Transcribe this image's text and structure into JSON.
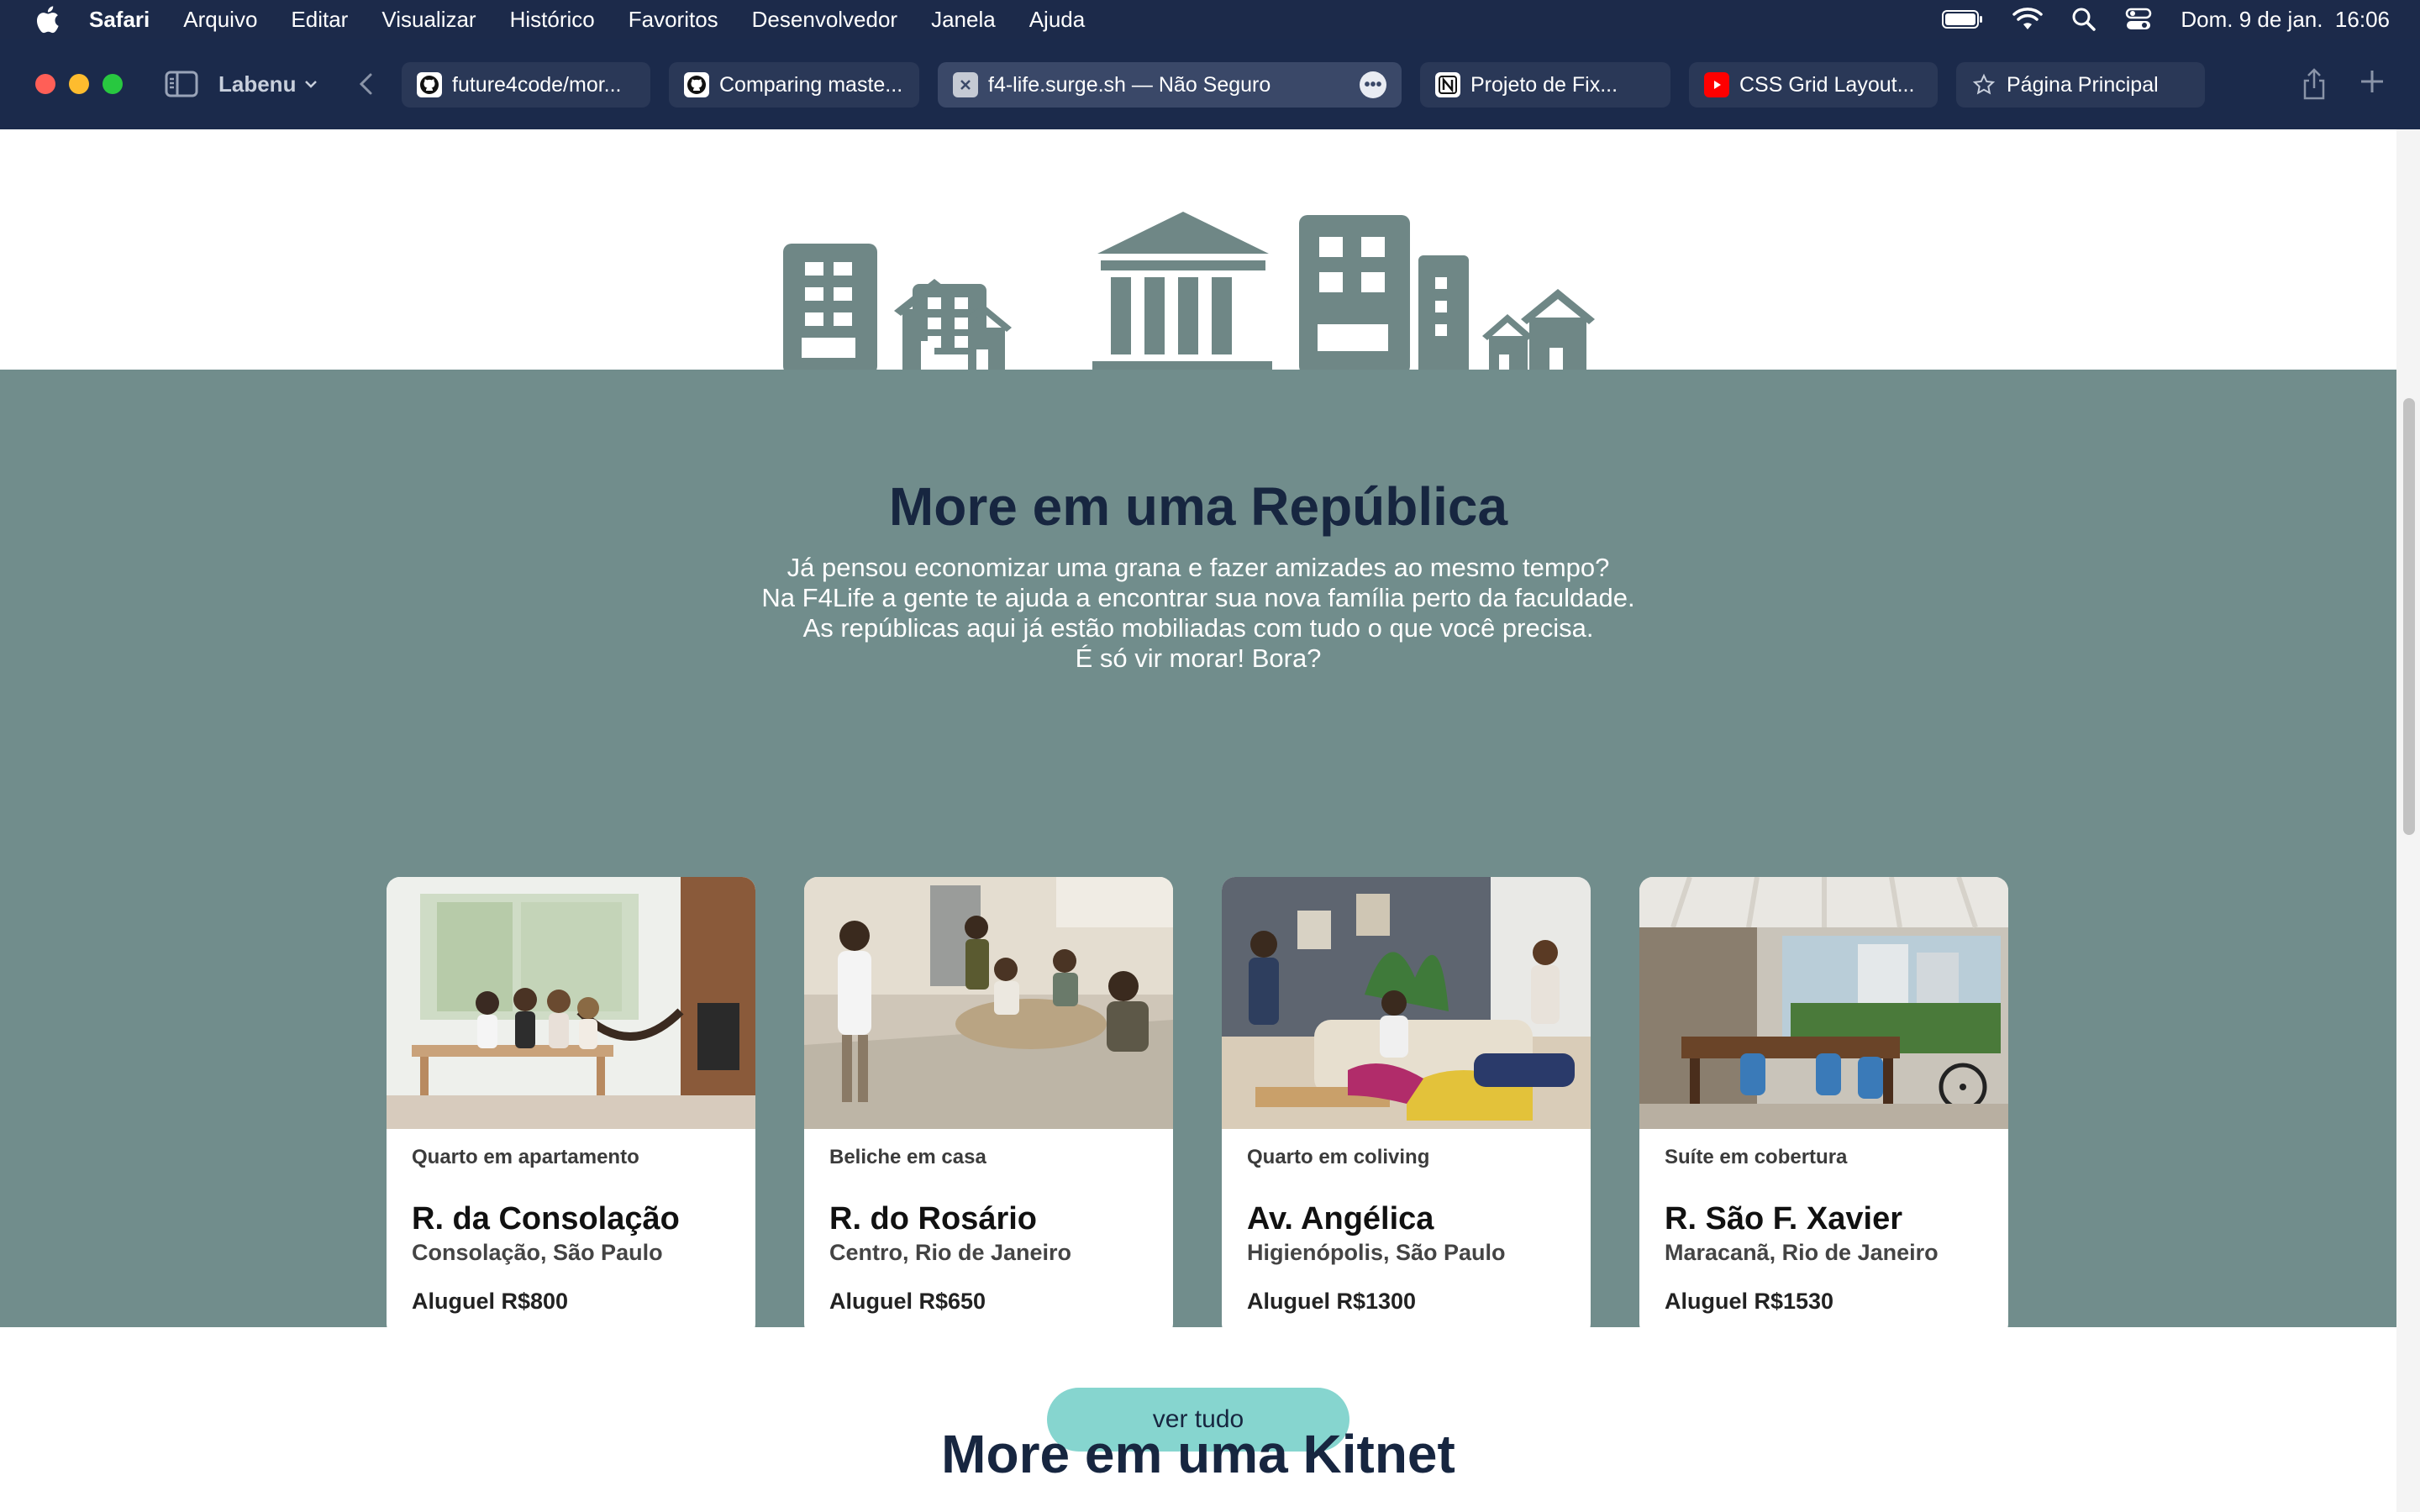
{
  "menubar": {
    "app": "Safari",
    "items": [
      "Arquivo",
      "Editar",
      "Visualizar",
      "Histórico",
      "Favoritos",
      "Desenvolvedor",
      "Janela",
      "Ajuda"
    ],
    "datetime": "Dom. 9 de jan.  16:06"
  },
  "browser": {
    "tab_group": "Labenu",
    "tabs": [
      {
        "label": "future4code/mor...",
        "icon": "github-icon"
      },
      {
        "label": "Comparing maste...",
        "icon": "github-icon"
      },
      {
        "label": "f4-life.surge.sh — Não Seguro",
        "icon": "close-icon",
        "active": true
      },
      {
        "label": "Projeto de Fix...",
        "icon": "notion-icon"
      },
      {
        "label": "CSS Grid Layout...",
        "icon": "youtube-icon"
      },
      {
        "label": "Página Principal",
        "icon": "star-icon"
      }
    ]
  },
  "hero": {
    "title": "More em uma República",
    "lines": [
      "Já pensou economizar uma grana e fazer amizades ao mesmo tempo?",
      "Na F4Life a gente te ajuda a encontrar sua nova família perto da faculdade.",
      "As repúblicas aqui já estão mobiliadas com tudo o que você precisa.",
      "É só vir morar! Bora?"
    ],
    "cards": [
      {
        "type": "Quarto em apartamento",
        "street": "R. da Consolação",
        "area": "Consolação, São Paulo",
        "rent": "Aluguel R$800"
      },
      {
        "type": "Beliche em casa",
        "street": "R. do Rosário",
        "area": "Centro, Rio de Janeiro",
        "rent": "Aluguel R$650"
      },
      {
        "type": "Quarto em coliving",
        "street": "Av. Angélica",
        "area": "Higienópolis, São Paulo",
        "rent": "Aluguel R$1300"
      },
      {
        "type": "Suíte em cobertura",
        "street": "R. São F. Xavier",
        "area": "Maracanã, Rio de Janeiro",
        "rent": "Aluguel R$1530"
      }
    ],
    "button": "ver tudo"
  },
  "kitnet": {
    "title": "More em uma Kitnet"
  },
  "colors": {
    "hero_bg": "#718d8c",
    "title": "#172640",
    "button": "#86d5cf",
    "skyline": "#6f8786"
  }
}
